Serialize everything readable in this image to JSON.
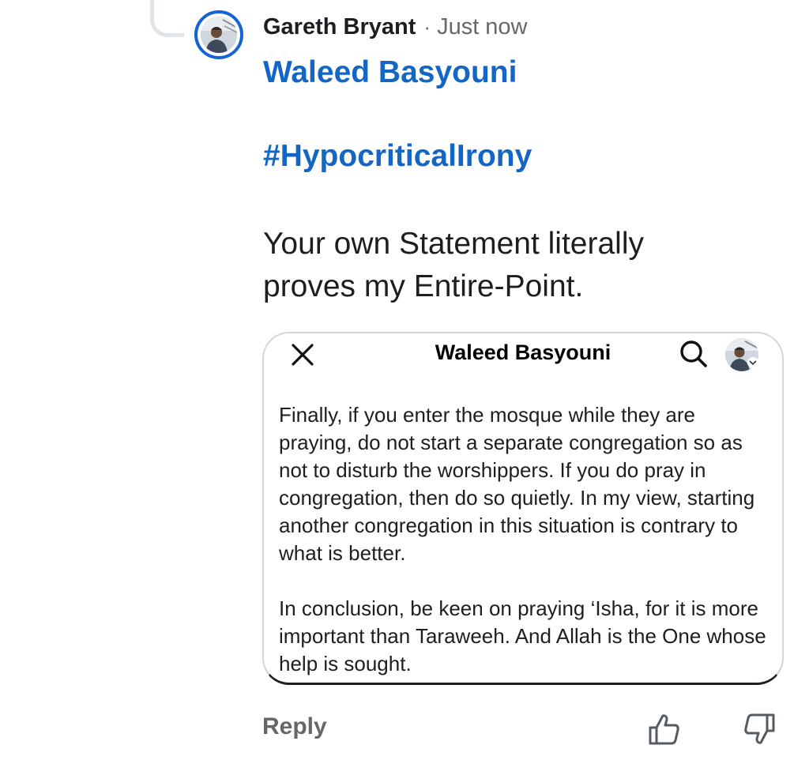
{
  "comment": {
    "author": "Gareth Bryant",
    "separator": "·",
    "timestamp": "Just now",
    "mention": "Waleed Basyouni",
    "hashtag": "#HypocriticalIrony",
    "text": "Your own Statement literally proves my Entire-Point."
  },
  "embedded_screenshot": {
    "title": "Waleed Basyouni",
    "paragraphs": [
      "Finally, if you enter the mosque while they are praying, do not start a separate congregation so as not to disturb the worshippers. If you do pray in congregation, then do so quietly. In my view, starting another congregation in this situation is contrary to what is better.",
      "In conclusion, be keen on praying ‘Isha, for it is more important than Taraweeh. And Allah is the One whose help is sought."
    ],
    "icons": [
      "close-icon",
      "search-icon",
      "profile-avatar"
    ]
  },
  "actions": {
    "reply_label": "Reply",
    "icons": [
      "thumbs-up-icon",
      "thumbs-down-icon"
    ]
  },
  "colors": {
    "accent": "#1466c4",
    "avatar_ring": "#1464d6",
    "secondary_text": "#65676b",
    "primary_text": "#1c1e21"
  }
}
